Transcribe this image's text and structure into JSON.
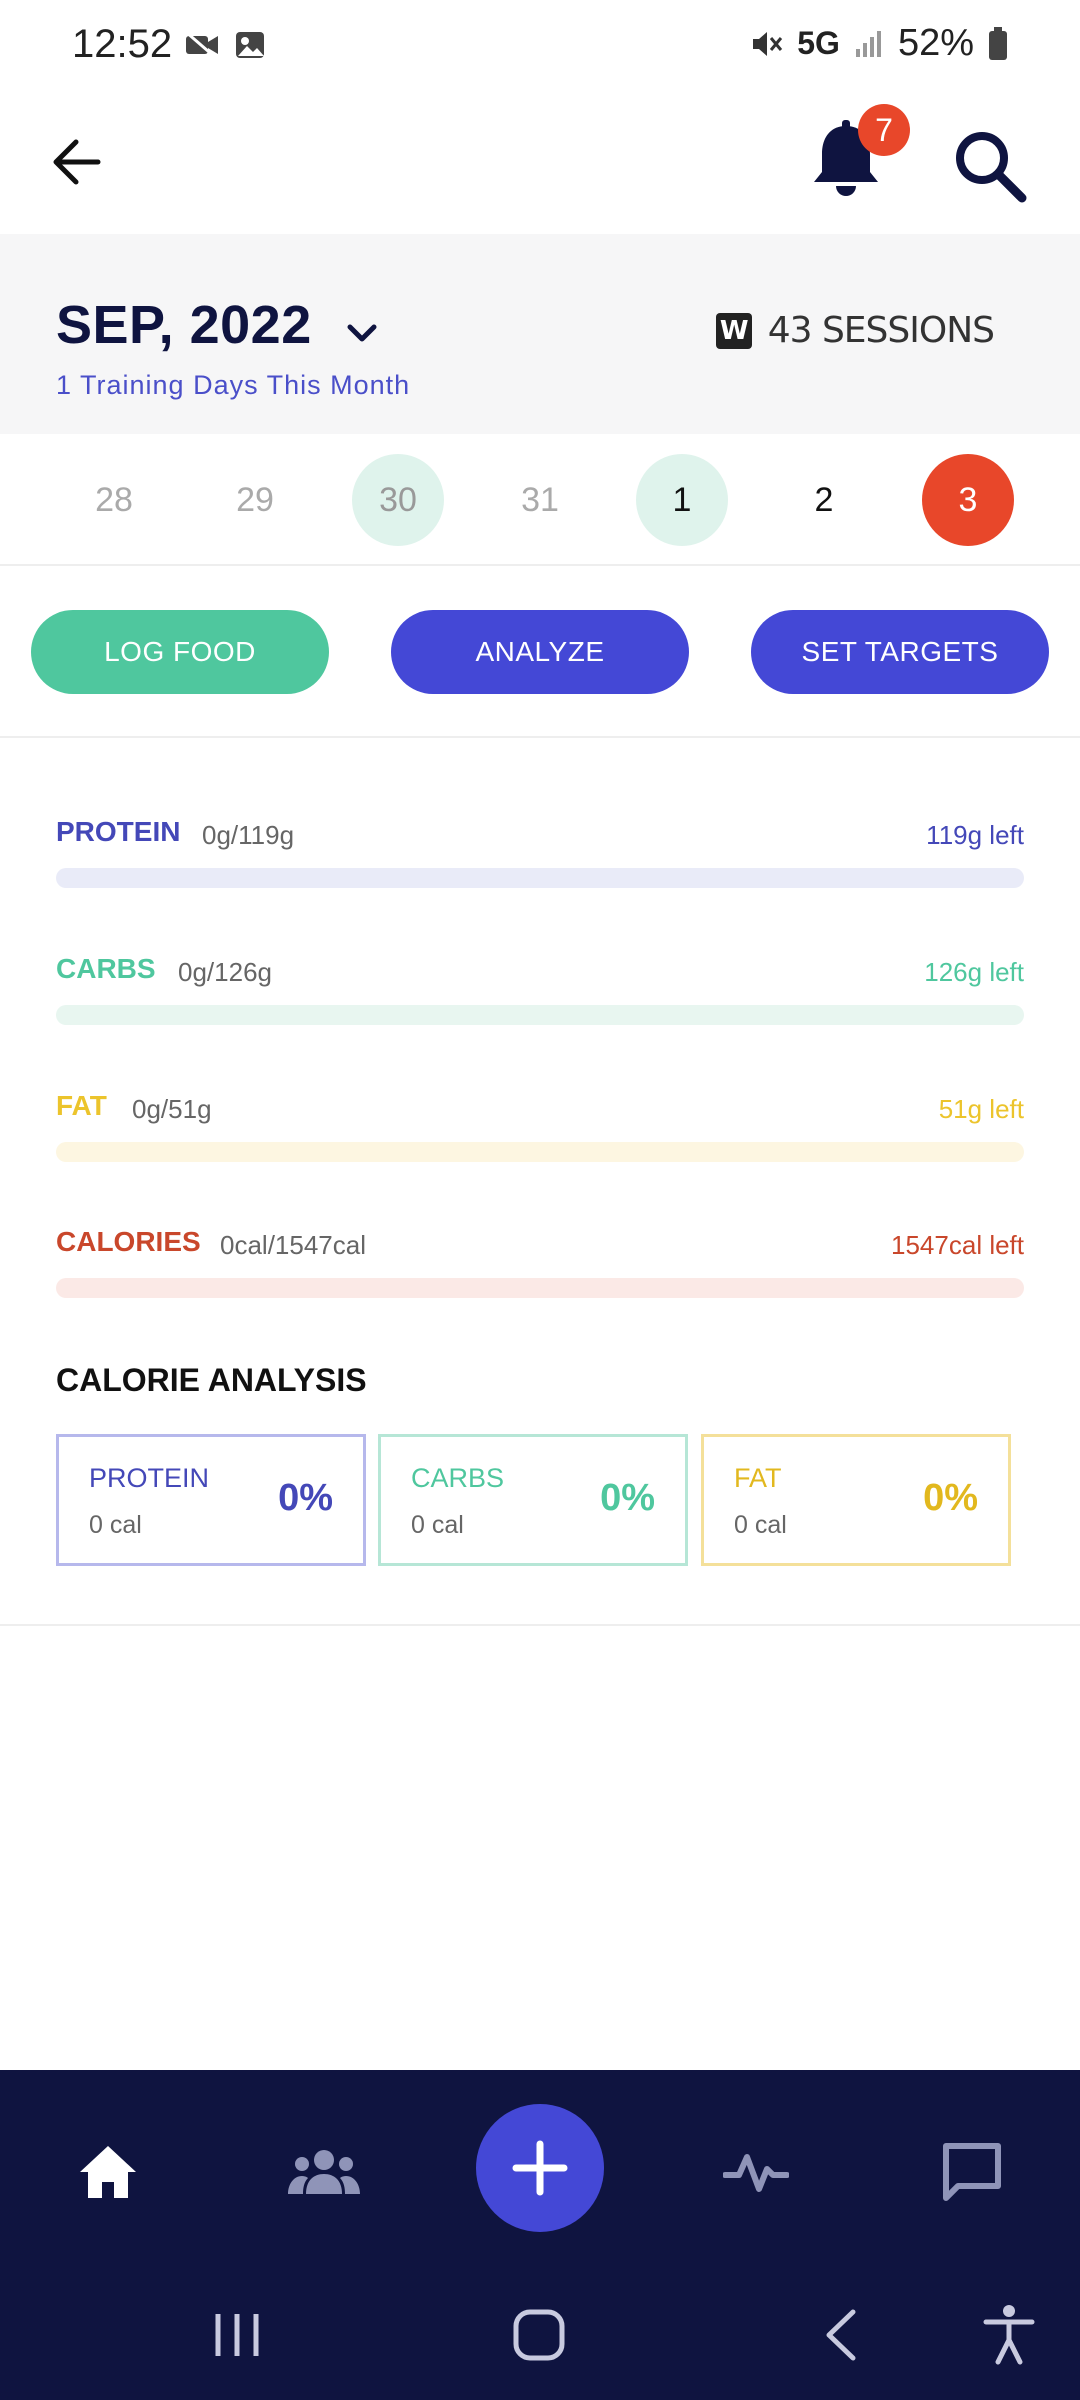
{
  "status": {
    "time": "12:52",
    "network": "5G",
    "battery": "52%"
  },
  "header": {
    "notification_count": "7"
  },
  "month": {
    "title": "SEP, 2022",
    "subtitle": "1 Training Days This Month",
    "sessions": "43 SESSIONS"
  },
  "dates": [
    "28",
    "29",
    "30",
    "31",
    "1",
    "2",
    "3"
  ],
  "actions": {
    "log_food": "LOG FOOD",
    "analyze": "ANALYZE",
    "set_targets": "SET TARGETS"
  },
  "macros": [
    {
      "name": "PROTEIN",
      "amount": "0g/119g",
      "left": "119g left",
      "progress": 0,
      "color": "#4448b8",
      "track": "#e9ebf8"
    },
    {
      "name": "CARBS",
      "amount": "0g/126g",
      "left": "126g left",
      "progress": 0,
      "color": "#4fc79e",
      "track": "#e8f6f0"
    },
    {
      "name": "FAT",
      "amount": "0g/51g",
      "left": "51g left",
      "progress": 0,
      "color": "#ecc42c",
      "track": "#fdf6e1"
    },
    {
      "name": "CALORIES",
      "amount": "0cal/1547cal",
      "left": "1547cal left",
      "progress": 0,
      "color": "#c9472b",
      "track": "#fbe9e6"
    }
  ],
  "calorie_analysis": {
    "title": "CALORIE ANALYSIS",
    "cards": [
      {
        "name": "PROTEIN",
        "cal": "0 cal",
        "pct": "0%",
        "color": "#4448b8",
        "border": "#b6b8ec"
      },
      {
        "name": "CARBS",
        "cal": "0 cal",
        "pct": "0%",
        "color": "#4fc79e",
        "border": "#b6e6d6"
      },
      {
        "name": "FAT",
        "cal": "0 cal",
        "pct": "0%",
        "color": "#e2b81e",
        "border": "#f4e09a"
      }
    ]
  },
  "colors": {
    "accent_blue": "#4448d6",
    "accent_green": "#4fc79e",
    "accent_red": "#e8472a",
    "navy": "#0f1440"
  },
  "icons": {
    "back": "arrow-left-icon",
    "bell": "bell-icon",
    "search": "search-icon",
    "home": "home-icon",
    "community": "group-icon",
    "add": "plus-icon",
    "activity": "pulse-icon",
    "messages": "chat-icon"
  }
}
